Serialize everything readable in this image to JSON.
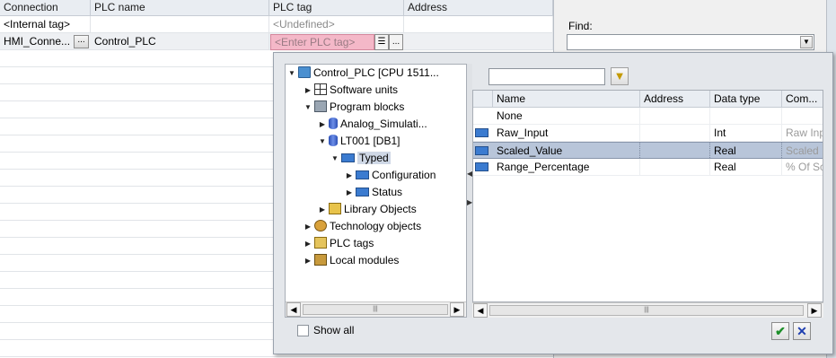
{
  "table": {
    "headers": [
      "Connection",
      "PLC name",
      "PLC tag",
      "Address"
    ],
    "rows": [
      {
        "connection": "<Internal tag>",
        "plc_name": "",
        "plc_tag": "<Undefined>",
        "address": ""
      },
      {
        "connection": "HMI_Conne...",
        "plc_name": "Control_PLC",
        "plc_tag": "<Enter PLC tag>",
        "address": ""
      }
    ],
    "ellipsis_label": "...",
    "ellipsis_label_2": "..."
  },
  "find_panel": {
    "label": "Find:",
    "value": ""
  },
  "popup": {
    "tree": [
      {
        "label": "Control_PLC [CPU 1511...",
        "expanded": true,
        "icon": "plc-icon"
      },
      {
        "label": "Software units",
        "icon": "software-units-icon"
      },
      {
        "label": "Program blocks",
        "expanded": true,
        "icon": "program-blocks-icon"
      },
      {
        "label": "Analog_Simulati...",
        "icon": "db-icon"
      },
      {
        "label": "LT001 [DB1]",
        "expanded": true,
        "icon": "db-icon"
      },
      {
        "label": "Typed",
        "expanded": true,
        "selected": true,
        "icon": "struct-icon"
      },
      {
        "label": "Configuration",
        "icon": "struct-icon"
      },
      {
        "label": "Status",
        "icon": "struct-icon"
      },
      {
        "label": "Library Objects",
        "icon": "library-icon"
      },
      {
        "label": "Technology objects",
        "icon": "technology-icon"
      },
      {
        "label": "PLC tags",
        "icon": "plc-tags-icon"
      },
      {
        "label": "Local modules",
        "icon": "local-modules-icon"
      }
    ],
    "search_value": "",
    "columns": [
      "Name",
      "Address",
      "Data type",
      "Com..."
    ],
    "tags": [
      {
        "name": "None",
        "address": "",
        "type": "",
        "comment": "",
        "icon": false
      },
      {
        "name": "Raw_Input",
        "address": "",
        "type": "Int",
        "comment": "Raw Inp",
        "icon": true
      },
      {
        "name": "Scaled_Value",
        "address": "",
        "type": "Real",
        "comment": "Scaled",
        "icon": true,
        "selected": true
      },
      {
        "name": "Range_Percentage",
        "address": "",
        "type": "Real",
        "comment": "% Of Sc",
        "icon": true
      }
    ],
    "show_all_label": "Show all",
    "show_all_checked": false,
    "ok_symbol": "✔",
    "cancel_symbol": "✕"
  }
}
